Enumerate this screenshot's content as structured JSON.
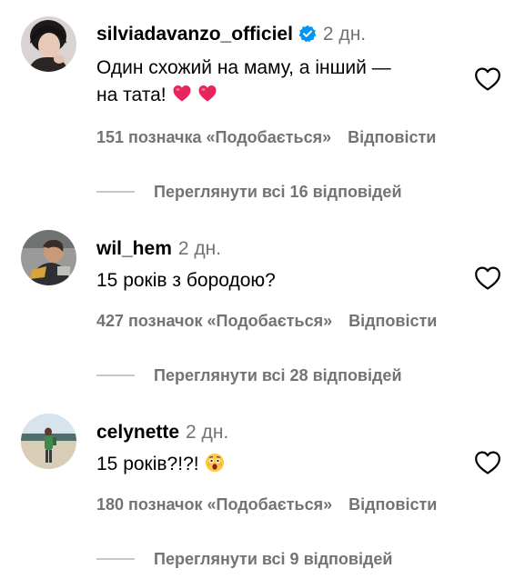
{
  "comments": [
    {
      "username": "silviadavanzo_officiel",
      "verified": true,
      "time": "2 дн.",
      "text_line1": "Один схожий на маму, а інший —",
      "text_line2": "на тата!",
      "emojis": [
        "heart-emoji",
        "heart-emoji"
      ],
      "likes": "151 позначка «Подобається»",
      "reply": "Відповісти",
      "view_replies": "Переглянути всі 16 відповідей"
    },
    {
      "username": "wil_hem",
      "verified": false,
      "time": "2 дн.",
      "text_line1": "15 років з бородою?",
      "likes": "427 позначок «Подобається»",
      "reply": "Відповісти",
      "view_replies": "Переглянути всі 28 відповідей"
    },
    {
      "username": "celynette",
      "verified": false,
      "time": "2 дн.",
      "text_line1": "15 років?!?!",
      "emojis": [
        "astonished-face-emoji"
      ],
      "likes": "180 позначок «Подобається»",
      "reply": "Відповісти",
      "view_replies": "Переглянути всі 9 відповідей"
    }
  ],
  "icons": {
    "like": "heart-outline-icon",
    "verified": "verified-badge-icon"
  },
  "colors": {
    "secondary_text": "#737373",
    "verified_blue": "#0095f6",
    "heart_pink": "#e8245c",
    "divider": "#c7c7c7"
  }
}
